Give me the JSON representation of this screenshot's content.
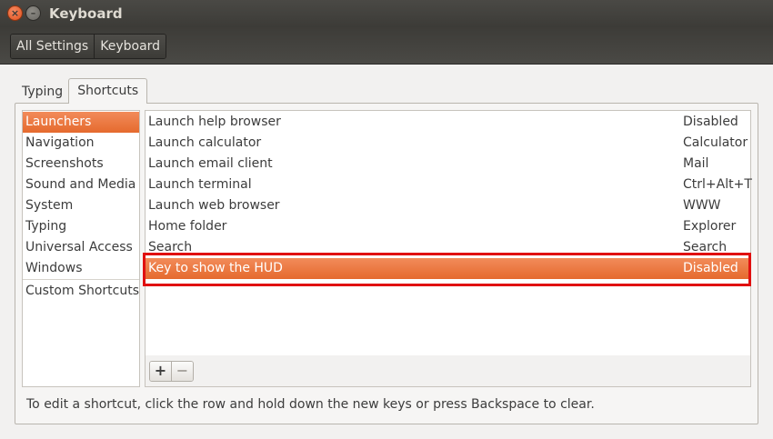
{
  "window": {
    "title": "Keyboard"
  },
  "titlebar": {
    "close_glyph": "×",
    "minimize_glyph": "–"
  },
  "breadcrumbs": [
    "All Settings",
    "Keyboard"
  ],
  "tabs": [
    {
      "label": "Typing",
      "active": false
    },
    {
      "label": "Shortcuts",
      "active": true
    }
  ],
  "categories": [
    {
      "label": "Launchers",
      "selected": true
    },
    {
      "label": "Navigation"
    },
    {
      "label": "Screenshots"
    },
    {
      "label": "Sound and Media"
    },
    {
      "label": "System"
    },
    {
      "label": "Typing"
    },
    {
      "label": "Universal Access"
    },
    {
      "label": "Windows"
    },
    {
      "label": "Custom Shortcuts"
    }
  ],
  "shortcuts": [
    {
      "action": "Launch help browser",
      "accel": "Disabled"
    },
    {
      "action": "Launch calculator",
      "accel": "Calculator"
    },
    {
      "action": "Launch email client",
      "accel": "Mail"
    },
    {
      "action": "Launch terminal",
      "accel": "Ctrl+Alt+T"
    },
    {
      "action": "Launch web browser",
      "accel": "WWW"
    },
    {
      "action": "Home folder",
      "accel": "Explorer"
    },
    {
      "action": "Search",
      "accel": "Search"
    },
    {
      "action": "Key to show the HUD",
      "accel": "Disabled",
      "selected": true
    }
  ],
  "buttons": {
    "add": "+",
    "remove": "−"
  },
  "hint": "To edit a shortcut, click the row and hold down the new keys or press Backspace to clear.",
  "colors": {
    "accent": "#e96e33",
    "annotation": "#e01010",
    "titlebar": "#3c3b37"
  }
}
